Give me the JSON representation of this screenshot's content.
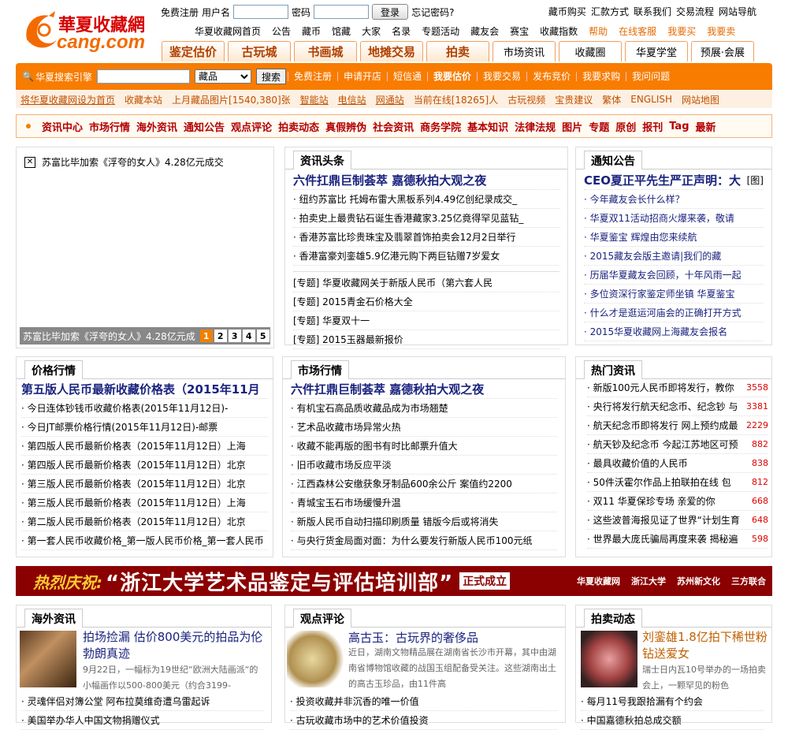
{
  "logo": {
    "cn": "華夏收藏網",
    "en": "cang.com"
  },
  "login": {
    "register": "免费注册",
    "user_label": "用户名",
    "pwd_label": "密码",
    "login_btn": "登录",
    "forgot": "忘记密码?"
  },
  "toplinks": [
    "藏币购买",
    "汇款方式",
    "联系我们",
    "交易流程",
    "网站导航"
  ],
  "mainnav": [
    {
      "t": "华夏收藏网首页",
      "o": false
    },
    {
      "t": "公告",
      "o": false
    },
    {
      "t": "藏币",
      "o": false
    },
    {
      "t": "馆藏",
      "o": false
    },
    {
      "t": "大家",
      "o": false
    },
    {
      "t": "名录",
      "o": false
    },
    {
      "t": "专题活动",
      "o": false
    },
    {
      "t": "藏友会",
      "o": false
    },
    {
      "t": "赛宝",
      "o": false
    },
    {
      "t": "收藏指数",
      "o": false
    },
    {
      "t": "帮助",
      "o": true
    },
    {
      "t": "在线客服",
      "o": true
    },
    {
      "t": "我要买",
      "o": true
    },
    {
      "t": "我要卖",
      "o": true
    }
  ],
  "tabs": [
    {
      "t": "鉴定估价",
      "w": 80,
      "plain": false
    },
    {
      "t": "古玩城",
      "w": 80,
      "plain": false
    },
    {
      "t": "书画城",
      "w": 80,
      "plain": false
    },
    {
      "t": "地摊交易",
      "w": 80,
      "plain": false
    },
    {
      "t": "拍卖",
      "w": 80,
      "plain": false
    },
    {
      "t": "市场资讯",
      "w": 80,
      "plain": true
    },
    {
      "t": "收藏圈",
      "w": 80,
      "plain": true
    },
    {
      "t": "华夏学堂",
      "w": 80,
      "plain": true
    },
    {
      "t": "预展·会展",
      "w": 80,
      "plain": true
    }
  ],
  "search": {
    "label": "华夏搜索引擎",
    "select": "藏品",
    "btn": "搜索",
    "links": [
      "免费注册",
      "申请开店",
      "短信通",
      "我要估价",
      "我要交易",
      "发布竞价",
      "我要求购",
      "我问问题"
    ]
  },
  "subbar": [
    "将华夏收藏网设为首页",
    "收藏本站",
    "上月藏品图片[1540,380]张",
    "智能站",
    "电信站",
    "网通站",
    "当前在线[18265]人",
    "古玩视频",
    "宝贵建议",
    "繁体",
    "ENGLISH",
    "网站地图"
  ],
  "catnav": [
    "资讯中心",
    "市场行情",
    "海外资讯",
    "通知公告",
    "观点评论",
    "拍卖动态",
    "真假辨伪",
    "社会资讯",
    "商务学院",
    "基本知识",
    "法律法规",
    "图片",
    "专题",
    "原创",
    "报刊",
    "Tag",
    "最新"
  ],
  "slide": {
    "title": "苏富比毕加索《浮夸的女人》4.28亿元成交",
    "caption": "苏富比毕加索《浮夸的女人》4.28亿元成",
    "pages": [
      "1",
      "2",
      "3",
      "4",
      "5"
    ]
  },
  "headlines": {
    "title": "资讯头条",
    "top": "六件扛鼎巨制荟萃 嘉德秋拍大观之夜",
    "items": [
      "纽约苏富比 托姆布雷大黑板系列4.49亿创纪录成交_",
      "拍卖史上最贵钻石诞生香港藏家3.25亿竟得罕见蓝钻_",
      "香港苏富比珍贵珠宝及翡翠首饰拍卖会12月2日举行",
      "香港富豪刘銮雄5.9亿港元购下两巨钻赠7岁爱女"
    ],
    "specials": [
      "[专题] 华夏收藏网关于新版人民币（第六套人民",
      "[专题] 2015青金石价格大全",
      "[专题] 华夏双十一",
      "[专题] 2015玉器最新报价"
    ]
  },
  "notice": {
    "title": "通知公告",
    "top": "CEO夏正平先生严正声明：大",
    "tag": "[图]",
    "items": [
      "今年藏友会长什么样？",
      "华夏双11活动招商火爆来袭，敬请",
      "华夏鉴宝 辉煌由您来续航",
      "2015藏友会版主邀请|我们的藏",
      "历届华夏藏友会回顾，十年风雨一起",
      "多位资深行家鉴定师坐镇 华夏鉴宝",
      "什么才是逛运河庙会的正确打开方式",
      "2015华夏收藏网上海藏友会报名"
    ]
  },
  "prices": {
    "title": "价格行情",
    "top": "第五版人民币最新收藏价格表（2015年11月",
    "items": [
      "今日连体钞钱币收藏价格表(2015年11月12日)-",
      "今日JT邮票价格行情(2015年11月12日)-邮票",
      "第四版人民币最新价格表（2015年11月12日）上海",
      "第四版人民币最新价格表（2015年11月12日）北京",
      "第三版人民币最新价格表（2015年11月12日）北京",
      "第三版人民币最新价格表（2015年11月12日）上海",
      "第二版人民币最新价格表（2015年11月12日）北京",
      "第一套人民币收藏价格_第一版人民币价格_第一套人民币"
    ]
  },
  "market": {
    "title": "市场行情",
    "top": "六件扛鼎巨制荟萃 嘉德秋拍大观之夜",
    "items": [
      "有机宝石高品质收藏品成为市场翘楚",
      "艺术品收藏市场异常火热",
      "收藏不能再版的图书有时比邮票升值大",
      "旧币收藏市场反应平淡",
      "江西森林公安缴获象牙制品600余公斤 案值约2200",
      "青城宝玉石市场缓慢升温",
      "新版人民币自动扫描印刷质量 错版今后或将消失",
      "与央行货金局面对面：为什么要发行新版人民币100元纸"
    ]
  },
  "hot": {
    "title": "热门资讯",
    "items": [
      {
        "t": "新版100元人民币即将发行，教你",
        "n": "3558"
      },
      {
        "t": "央行将发行航天纪念币、纪念钞 与",
        "n": "3381"
      },
      {
        "t": "航天纪念币即将发行 网上预约成最",
        "n": "2229"
      },
      {
        "t": "航天钞及纪念币 今起江苏地区可预",
        "n": "882"
      },
      {
        "t": "最具收藏价值的人民币",
        "n": "838"
      },
      {
        "t": "50件沃霍尔作品上拍联拍在线 包",
        "n": "812"
      },
      {
        "t": "双11 华夏保珍专场 亲爱的你",
        "n": "668"
      },
      {
        "t": "这些波普海报见证了世界“计划生育",
        "n": "648"
      },
      {
        "t": "世界最大庞氏骗局再度来袭 揭秘遍",
        "n": "598"
      }
    ]
  },
  "banner": {
    "lead": "热烈庆祝:",
    "main": "“浙江大学艺术品鉴定与评估培训部”",
    "tail": "正式成立",
    "orgs": [
      "华夏收藏网",
      "浙江大学",
      "苏州新文化",
      "三方联合"
    ]
  },
  "overseas": {
    "title": "海外资讯",
    "headline": "拍场捡漏 估价800美元的拍品为伦勃朗真迹",
    "desc": "9月22日，一幅标为19世纪“欧洲大陆画派“的小幅画作以500-800美元（约合3199-",
    "items": [
      "灵魂伴侣对簿公堂 阿布拉莫维奇遭乌雷起诉",
      "美国举办华人中国文物捐赠仪式"
    ]
  },
  "opinion": {
    "title": "观点评论",
    "headline": "高古玉：古玩界的奢侈品",
    "desc": "近日，湖南文物精品展在湖南省长沙市开幕，其中由湖南省博物馆收藏的战国玉组配备受关注。这些湖南出土的高古玉珍品，由11件高",
    "items": [
      "投资收藏并非沉香的唯一价值",
      "古玩收藏市场中的艺术价值投资"
    ]
  },
  "auction": {
    "title": "拍卖动态",
    "headline": "刘銮雄1.8亿拍下稀世粉钻送爱女",
    "desc": "瑞士日内瓦10号举办的一场拍卖会上，一颗罕见的粉色",
    "items": [
      "每月11号我跟拾漏有个约会",
      "中国嘉德秋拍总成交额"
    ]
  }
}
